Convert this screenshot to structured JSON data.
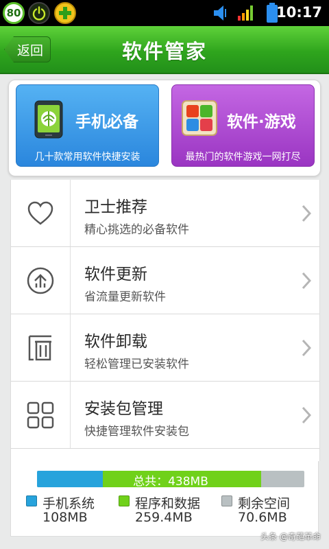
{
  "status_bar": {
    "badge": "80",
    "time": "10:17"
  },
  "header": {
    "back_label": "返回",
    "title": "软件管家"
  },
  "cards": [
    {
      "title": "手机必备",
      "subtitle": "几十款常用软件快捷安装",
      "icon": "phone-essentials-icon",
      "color": "#3b9ceb"
    },
    {
      "title": "软件·游戏",
      "subtitle": "最热门的软件游戏一网打尽",
      "icon": "apps-games-icon",
      "color": "#b04fd6"
    }
  ],
  "list": [
    {
      "title": "卫士推荐",
      "subtitle": "精心挑选的必备软件",
      "icon": "heart-icon"
    },
    {
      "title": "软件更新",
      "subtitle": "省流量更新软件",
      "icon": "update-icon"
    },
    {
      "title": "软件卸载",
      "subtitle": "轻松管理已安装软件",
      "icon": "trash-icon"
    },
    {
      "title": "安装包管理",
      "subtitle": "快捷管理软件安装包",
      "icon": "grid-icon"
    }
  ],
  "storage": {
    "total_label": "总共：438MB",
    "segments": [
      {
        "name": "手机系统",
        "value": "108MB",
        "fraction": 0.246,
        "color": "#27a3dc"
      },
      {
        "name": "程序和数据",
        "value": "259.4MB",
        "fraction": 0.592,
        "color": "#70d11a"
      },
      {
        "name": "剩余空间",
        "value": "70.6MB",
        "fraction": 0.162,
        "color": "#b9c0c2"
      }
    ]
  },
  "watermark": "头条 @奇葩革命"
}
